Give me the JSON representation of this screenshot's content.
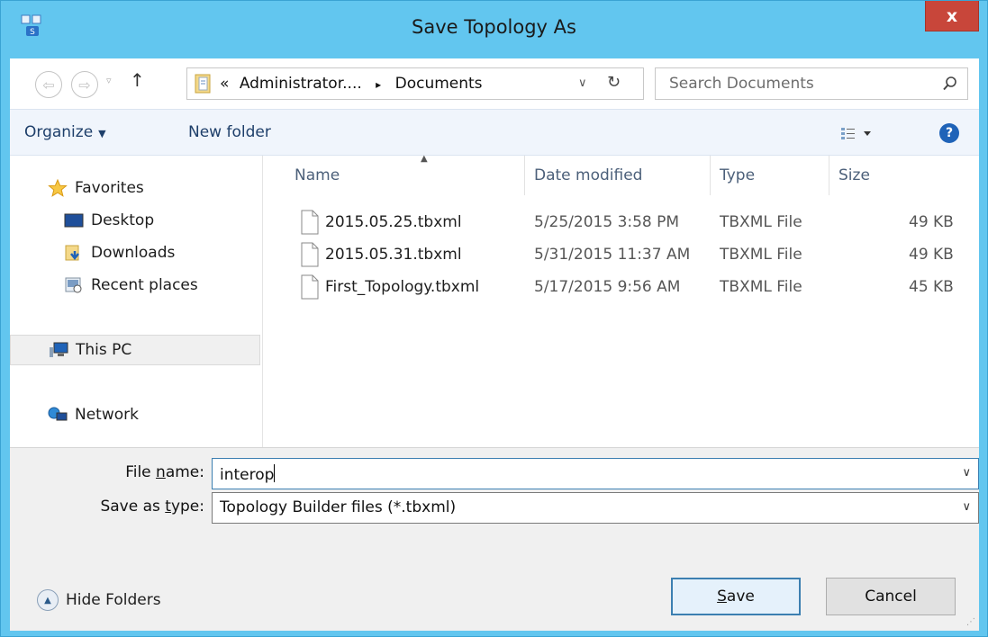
{
  "window": {
    "title": "Save Topology As",
    "close_label": "x"
  },
  "address": {
    "breadcrumb_prefix": "«",
    "breadcrumb": [
      "Administrator....",
      "Documents"
    ],
    "separator": "▸",
    "dropdown_glyph": "∨",
    "refresh_glyph": "↻",
    "search_placeholder": "Search Documents"
  },
  "nav_buttons": {
    "back": "⇦",
    "forward": "⇨",
    "recent": "▿",
    "up": "↑"
  },
  "toolbar": {
    "organize": "Organize",
    "organize_caret": "▼",
    "new_folder": "New folder",
    "view_caret": "▼",
    "help": "?"
  },
  "navigation": {
    "favorites": "Favorites",
    "items": [
      {
        "label": "Desktop",
        "icon": "desktop-icon"
      },
      {
        "label": "Downloads",
        "icon": "downloads-icon"
      },
      {
        "label": "Recent places",
        "icon": "recent-places-icon"
      }
    ],
    "this_pc": "This PC",
    "network": "Network"
  },
  "file_list": {
    "columns": [
      "Name",
      "Date modified",
      "Type",
      "Size"
    ],
    "sort_indicator": "▲",
    "rows": [
      {
        "name": "2015.05.25.tbxml",
        "date": "5/25/2015 3:58 PM",
        "type": "TBXML File",
        "size": "49 KB"
      },
      {
        "name": "2015.05.31.tbxml",
        "date": "5/31/2015 11:37 AM",
        "type": "TBXML File",
        "size": "49 KB"
      },
      {
        "name": "First_Topology.tbxml",
        "date": "5/17/2015 9:56 AM",
        "type": "TBXML File",
        "size": "45 KB"
      }
    ]
  },
  "form": {
    "filename_label_pre": "File ",
    "filename_label_ul": "n",
    "filename_label_post": "ame:",
    "filename_value": "interop",
    "savetype_label_pre": "Save as ",
    "savetype_label_ul": "t",
    "savetype_label_post": "ype:",
    "savetype_value": "Topology Builder files (*.tbxml)",
    "dropdown_glyph": "∨"
  },
  "footer": {
    "hide_folders": "Hide Folders",
    "hide_glyph": "▲",
    "save_ul": "S",
    "save_rest": "ave",
    "cancel": "Cancel",
    "grip": "⋰"
  },
  "colors": {
    "titlebar": "#62c6ef",
    "close": "#c8463a",
    "toolbar": "#f0f5fc",
    "accent": "#3c7fb1"
  }
}
